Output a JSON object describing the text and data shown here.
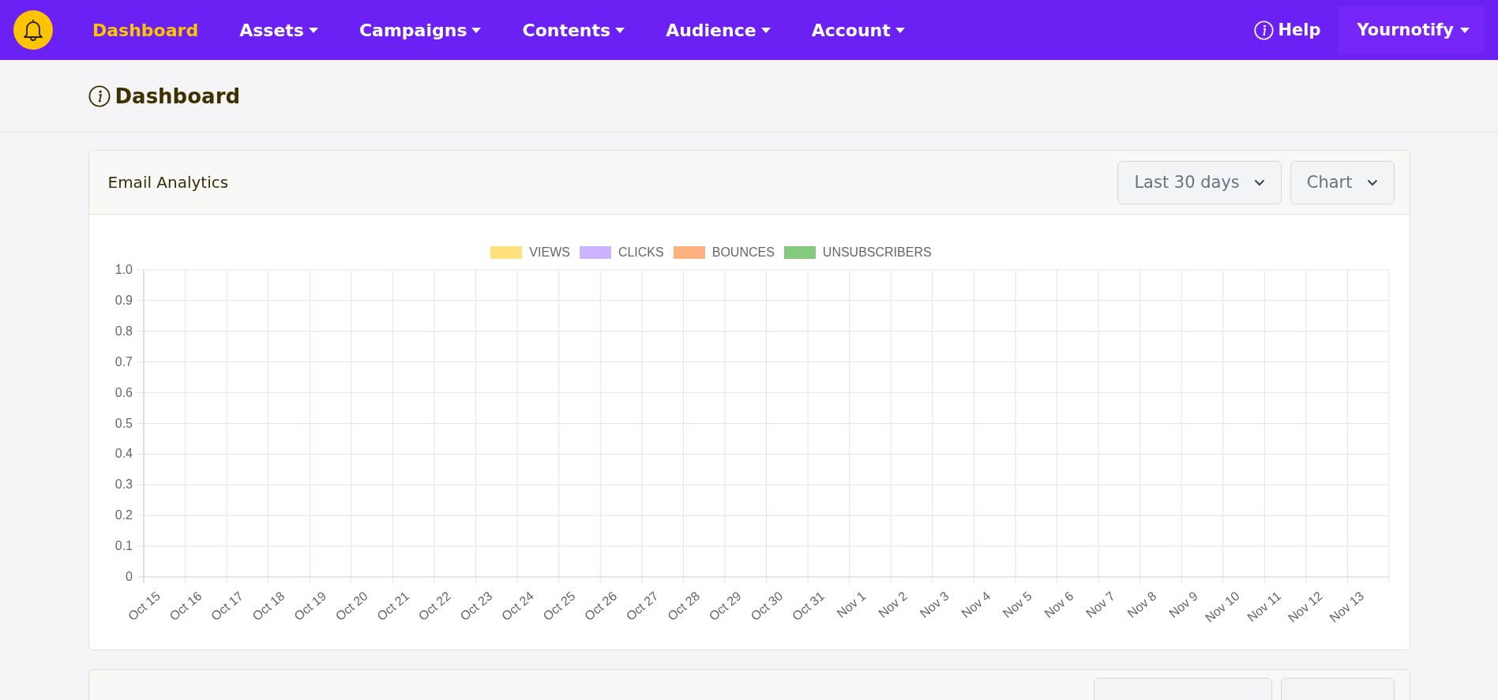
{
  "nav": {
    "items": [
      {
        "label": "Dashboard",
        "selected": true,
        "dropdown": false
      },
      {
        "label": "Assets",
        "selected": false,
        "dropdown": true
      },
      {
        "label": "Campaigns",
        "selected": false,
        "dropdown": true
      },
      {
        "label": "Contents",
        "selected": false,
        "dropdown": true
      },
      {
        "label": "Audience",
        "selected": false,
        "dropdown": true
      },
      {
        "label": "Account",
        "selected": false,
        "dropdown": true
      }
    ],
    "help": "Help",
    "account": "Yournotify"
  },
  "page_title": "Dashboard",
  "card": {
    "title": "Email Analytics",
    "filters": [
      "Last 30 days",
      "Chart"
    ],
    "chart_data": {
      "type": "line",
      "categories": [
        "Oct 15",
        "Oct 16",
        "Oct 17",
        "Oct 18",
        "Oct 19",
        "Oct 20",
        "Oct 21",
        "Oct 22",
        "Oct 23",
        "Oct 24",
        "Oct 25",
        "Oct 26",
        "Oct 27",
        "Oct 28",
        "Oct 29",
        "Oct 30",
        "Oct 31",
        "Nov 1",
        "Nov 2",
        "Nov 3",
        "Nov 4",
        "Nov 5",
        "Nov 6",
        "Nov 7",
        "Nov 8",
        "Nov 9",
        "Nov 10",
        "Nov 11",
        "Nov 12",
        "Nov 13"
      ],
      "series": [
        {
          "name": "VIEWS",
          "color": "#ffe07a",
          "values": [
            null,
            null,
            null,
            null,
            null,
            null,
            null,
            null,
            null,
            null,
            null,
            null,
            null,
            null,
            null,
            null,
            null,
            null,
            null,
            null,
            null,
            null,
            null,
            null,
            null,
            null,
            null,
            null,
            null,
            null
          ]
        },
        {
          "name": "CLICKS",
          "color": "#ccb3ff",
          "values": [
            null,
            null,
            null,
            null,
            null,
            null,
            null,
            null,
            null,
            null,
            null,
            null,
            null,
            null,
            null,
            null,
            null,
            null,
            null,
            null,
            null,
            null,
            null,
            null,
            null,
            null,
            null,
            null,
            null,
            null
          ]
        },
        {
          "name": "BOUNCES",
          "color": "#ffb07f",
          "values": [
            null,
            null,
            null,
            null,
            null,
            null,
            null,
            null,
            null,
            null,
            null,
            null,
            null,
            null,
            null,
            null,
            null,
            null,
            null,
            null,
            null,
            null,
            null,
            null,
            null,
            null,
            null,
            null,
            null,
            null
          ]
        },
        {
          "name": "UNSUBSCRIBERS",
          "color": "#85c97e",
          "values": [
            null,
            null,
            null,
            null,
            null,
            null,
            null,
            null,
            null,
            null,
            null,
            null,
            null,
            null,
            null,
            null,
            null,
            null,
            null,
            null,
            null,
            null,
            null,
            null,
            null,
            null,
            null,
            null,
            null,
            null
          ]
        }
      ],
      "grid": true,
      "ylim": [
        0,
        1
      ],
      "yticks": [
        0,
        0.1,
        0.2,
        0.3,
        0.4,
        0.5,
        0.6,
        0.7,
        0.8,
        0.9,
        {
          "value": 1,
          "label": "1.0"
        }
      ]
    }
  }
}
